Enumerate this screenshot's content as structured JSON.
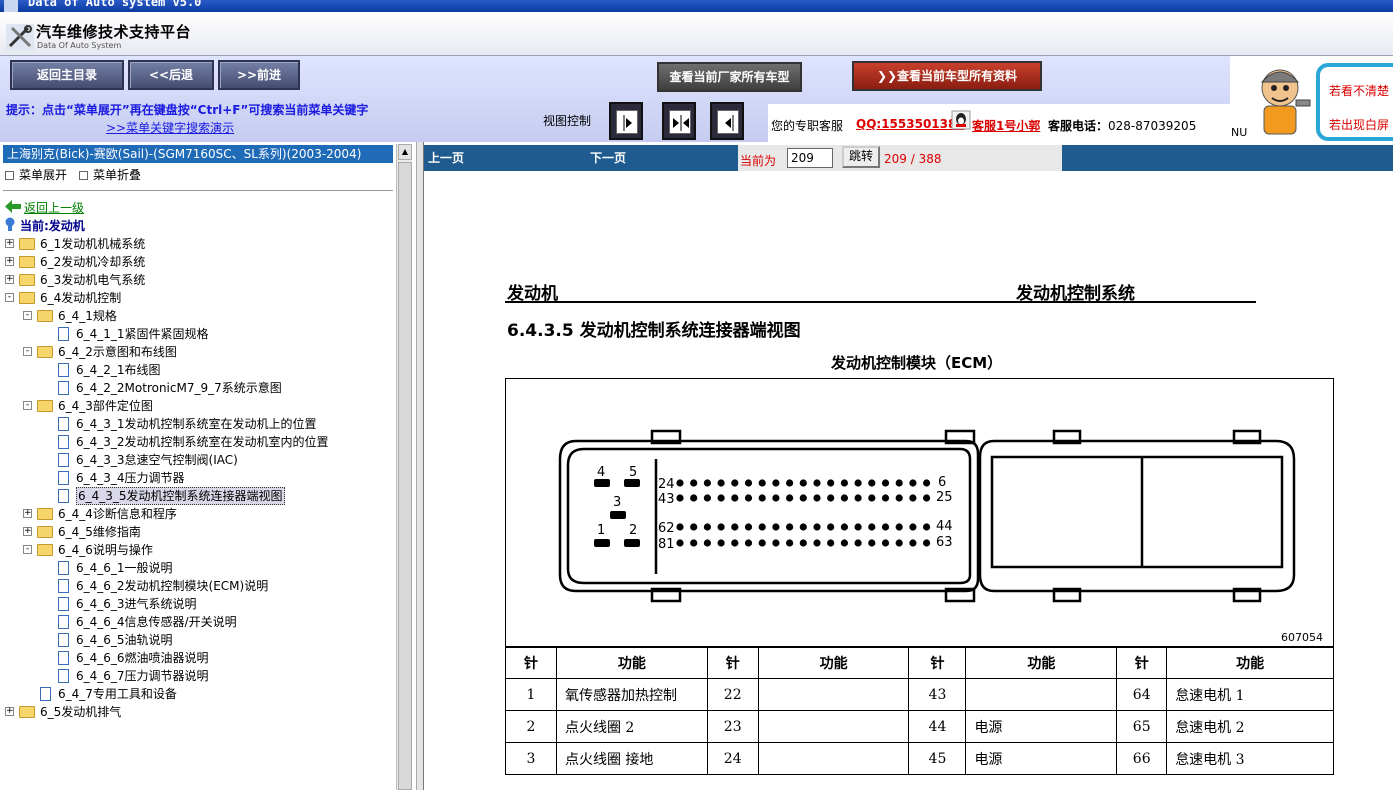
{
  "window": {
    "title": "Data of Auto system v5.0"
  },
  "app": {
    "title": "汽车维修技术支持平台",
    "subtitle": "Data Of Auto System"
  },
  "nav": {
    "home": "返回主目录",
    "back": "<<后退",
    "forward": ">>前进",
    "vendor_models": "查看当前厂家所有车型",
    "model_docs": "查看当前车型所有资料"
  },
  "tip": {
    "text": "提示：点击“菜单展开”再在键盘按“Ctrl+F”可搜索当前菜单关键字",
    "link": ">>菜单关键字搜索演示"
  },
  "view_control": {
    "label": "视图控制"
  },
  "service": {
    "text": "您的专职客服",
    "qq": "QQ:1553501388",
    "agent": "客服1号小郭",
    "phone_label": "客服电话：",
    "phone": "028-87039205"
  },
  "promo": {
    "line1": "若看不清楚",
    "line2": "若出现白屏",
    "nu": "NU"
  },
  "left": {
    "vehicle": "上海别克(Bick)-赛欧(Sail)-(SGM7160SC、SL系列)(2003-2004)",
    "expand": "菜单展开",
    "collapse": "菜单折叠",
    "back_up": "返回上一级",
    "current": "当前:发动机"
  },
  "tree": [
    {
      "label": "6_1发动机机械系统",
      "level": 0,
      "type": "folder",
      "state": "+"
    },
    {
      "label": "6_2发动机冷却系统",
      "level": 0,
      "type": "folder",
      "state": "+"
    },
    {
      "label": "6_3发动机电气系统",
      "level": 0,
      "type": "folder",
      "state": "+"
    },
    {
      "label": "6_4发动机控制",
      "level": 0,
      "type": "folder",
      "state": "-"
    },
    {
      "label": "6_4_1规格",
      "level": 1,
      "type": "folder",
      "state": "-"
    },
    {
      "label": "6_4_1_1紧固件紧固规格",
      "level": 2,
      "type": "doc"
    },
    {
      "label": "6_4_2示意图和布线图",
      "level": 1,
      "type": "folder",
      "state": "-"
    },
    {
      "label": "6_4_2_1布线图",
      "level": 2,
      "type": "doc"
    },
    {
      "label": "6_4_2_2MotronicM7_9_7系统示意图",
      "level": 2,
      "type": "doc"
    },
    {
      "label": "6_4_3部件定位图",
      "level": 1,
      "type": "folder",
      "state": "-"
    },
    {
      "label": "6_4_3_1发动机控制系统室在发动机上的位置",
      "level": 2,
      "type": "doc"
    },
    {
      "label": "6_4_3_2发动机控制系统室在发动机室内的位置",
      "level": 2,
      "type": "doc"
    },
    {
      "label": "6_4_3_3怠速空气控制阀(IAC)",
      "level": 2,
      "type": "doc"
    },
    {
      "label": "6_4_3_4压力调节器",
      "level": 2,
      "type": "doc"
    },
    {
      "label": "6_4_3_5发动机控制系统连接器端视图",
      "level": 2,
      "type": "doc",
      "selected": true
    },
    {
      "label": "6_4_4诊断信息和程序",
      "level": 1,
      "type": "folder",
      "state": "+"
    },
    {
      "label": "6_4_5维修指南",
      "level": 1,
      "type": "folder",
      "state": "+"
    },
    {
      "label": "6_4_6说明与操作",
      "level": 1,
      "type": "folder",
      "state": "-"
    },
    {
      "label": "6_4_6_1一般说明",
      "level": 2,
      "type": "doc"
    },
    {
      "label": "6_4_6_2发动机控制模块(ECM)说明",
      "level": 2,
      "type": "doc"
    },
    {
      "label": "6_4_6_3进气系统说明",
      "level": 2,
      "type": "doc"
    },
    {
      "label": "6_4_6_4信息传感器/开关说明",
      "level": 2,
      "type": "doc"
    },
    {
      "label": "6_4_6_5油轨说明",
      "level": 2,
      "type": "doc"
    },
    {
      "label": "6_4_6_6燃油喷油器说明",
      "level": 2,
      "type": "doc"
    },
    {
      "label": "6_4_6_7压力调节器说明",
      "level": 2,
      "type": "doc"
    },
    {
      "label": "6_4_7专用工具和设备",
      "level": 1,
      "type": "doc"
    },
    {
      "label": "6_5发动机排气",
      "level": 0,
      "type": "folder",
      "state": "+"
    }
  ],
  "pager": {
    "prev": "上一页",
    "next": "下一页",
    "current_label": "当前为",
    "current_value": "209",
    "jump": "跳转",
    "count": "209 / 388"
  },
  "document": {
    "header_left": "发动机",
    "header_right": "发动机控制系统",
    "section": "6.4.3.5 发动机控制系统连接器端视图",
    "figure_title": "发动机控制模块（ECM）",
    "figure_number": "607054",
    "pin_labels": [
      "4",
      "5",
      "3",
      "1",
      "2",
      "24",
      "6",
      "43",
      "25",
      "62",
      "44",
      "81",
      "63"
    ],
    "table": {
      "headers": [
        "针",
        "功能",
        "针",
        "功能",
        "针",
        "功能",
        "针",
        "功能"
      ],
      "rows": [
        [
          "1",
          "氧传感器加热控制",
          "22",
          "",
          "43",
          "",
          "64",
          "怠速电机 1"
        ],
        [
          "2",
          "点火线圈 2",
          "23",
          "",
          "44",
          "电源",
          "65",
          "怠速电机 2"
        ],
        [
          "3",
          "点火线圈 接地",
          "24",
          "",
          "45",
          "电源",
          "66",
          "怠速电机 3"
        ]
      ]
    }
  }
}
